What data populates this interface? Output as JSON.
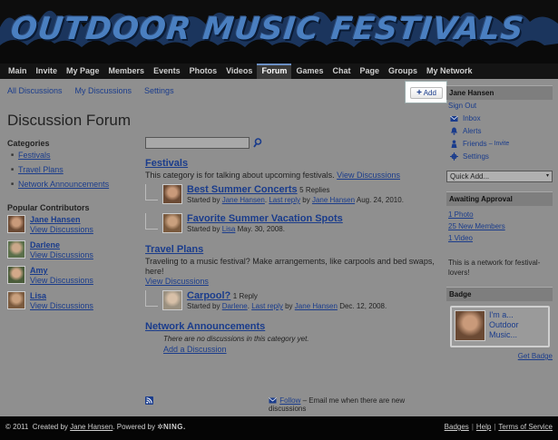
{
  "banner": {
    "title": "OUTDOOR MUSIC FESTIVALS"
  },
  "nav": [
    {
      "label": "Main"
    },
    {
      "label": "Invite"
    },
    {
      "label": "My Page"
    },
    {
      "label": "Members"
    },
    {
      "label": "Events"
    },
    {
      "label": "Photos"
    },
    {
      "label": "Videos"
    },
    {
      "label": "Forum",
      "active": true
    },
    {
      "label": "Games"
    },
    {
      "label": "Chat"
    },
    {
      "label": "Page"
    },
    {
      "label": "Groups"
    },
    {
      "label": "My Network"
    }
  ],
  "subnav": {
    "all": "All Discussions",
    "mine": "My Discussions",
    "settings": "Settings"
  },
  "add_button": {
    "plus": "+",
    "label": "Add"
  },
  "page_title": "Discussion Forum",
  "categories": {
    "heading": "Categories",
    "items": [
      "Festivals",
      "Travel Plans",
      "Network Announcements"
    ]
  },
  "contributors": {
    "heading": "Popular Contributors",
    "view_label": "View Discussions",
    "items": [
      {
        "name": "Jane Hansen",
        "color": "#6b4a34"
      },
      {
        "name": "Darlene",
        "color": "#5a6f4a"
      },
      {
        "name": "Amy",
        "color": "#4a5c3a"
      },
      {
        "name": "Lisa",
        "color": "#7a5a3e"
      }
    ]
  },
  "forum": {
    "festivals": {
      "title": "Festivals",
      "desc": "This category is for talking about upcoming festivals.",
      "view": "View Discussions",
      "discussions": [
        {
          "title": "Best Summer Concerts",
          "replies": "5 Replies",
          "started_by": "Started by",
          "author": "Jane Hansen",
          "sep": ".",
          "last_reply": "Last reply",
          "by": "by",
          "last_author": "Jane Hansen",
          "date": "Aug. 24, 2010."
        },
        {
          "title": "Favorite Summer Vacation Spots",
          "replies": "",
          "started_by": "Started by",
          "author": "Lisa",
          "date": "May. 30, 2008."
        }
      ]
    },
    "travel": {
      "title": "Travel Plans",
      "desc": "Traveling to a music festival? Make arrangements, like carpools and bed swaps, here!",
      "view": "View Discussions",
      "discussions": [
        {
          "title": "Carpool?",
          "replies": "1 Reply",
          "started_by": "Started by",
          "author": "Darlene",
          "sep": ".",
          "last_reply": "Last reply",
          "by": "by",
          "last_author": "Jane Hansen",
          "date": "Dec. 12, 2008."
        }
      ]
    },
    "announcements": {
      "title": "Network Announcements",
      "empty": "There are no discussions in this category yet.",
      "add": "Add a Discussion"
    }
  },
  "follow": {
    "label": "Follow",
    "text": "– Email me when there are new discussions"
  },
  "sidebar": {
    "user_name": "Jane Hansen",
    "sign_out": "Sign Out",
    "inbox": "Inbox",
    "alerts": "Alerts",
    "friends": "Friends",
    "invite": "– Invite",
    "settings": "Settings",
    "quick_add": "Quick Add...",
    "awaiting_heading": "Awaiting Approval",
    "approval": [
      "1 Photo",
      "25 New Members",
      "1 Video"
    ],
    "network_desc": "This is a network for festival-lovers!",
    "badge_heading": "Badge",
    "badge_text": [
      "I'm a...",
      "Outdoor",
      "Music..."
    ],
    "get_badge": "Get Badge"
  },
  "footer": {
    "copyright": "© 2011",
    "created_by": "Created by",
    "creator": "Jane Hansen",
    "powered_by": ".  Powered by",
    "ning": "NING.",
    "links": [
      "Badges",
      "Help",
      "Terms of Service"
    ]
  },
  "colors": {
    "link": "#1a3c8c",
    "banner_text": "#4a7fc0",
    "nav_bg": "#141414",
    "page_bg": "#8f8f8f"
  }
}
